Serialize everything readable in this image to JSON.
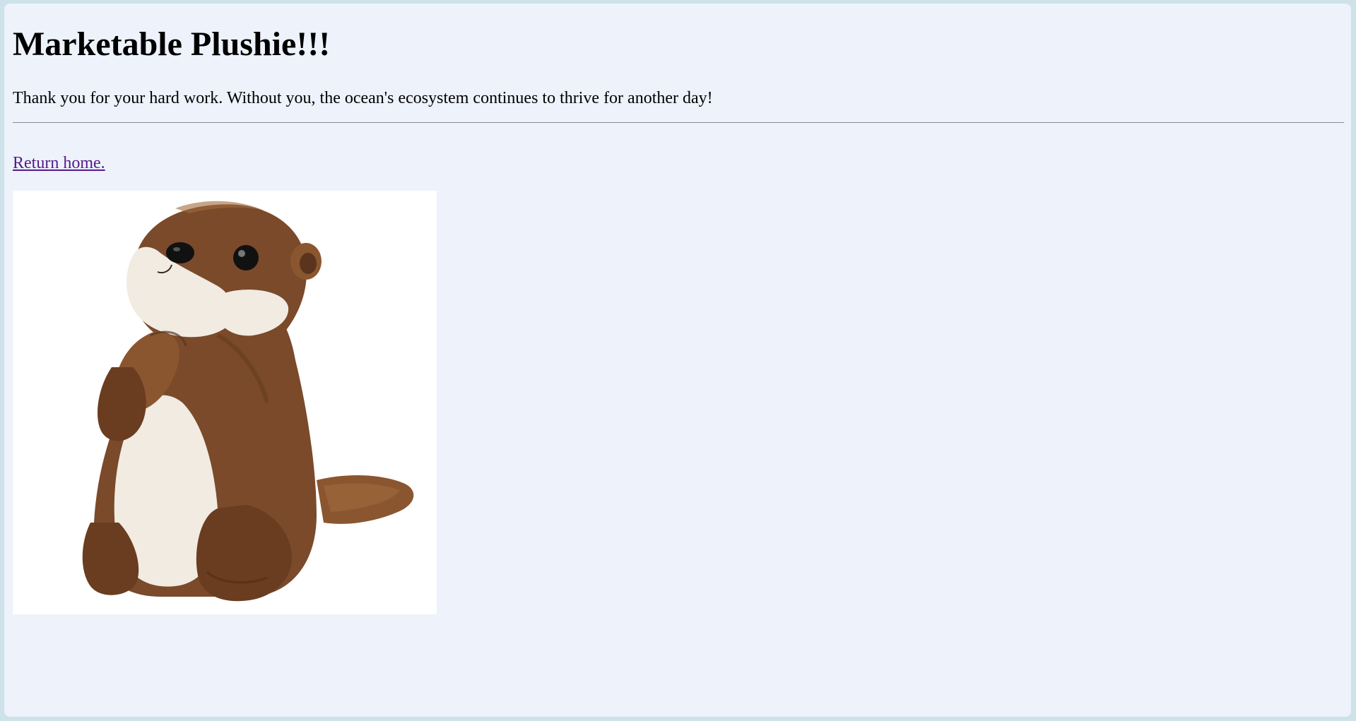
{
  "page": {
    "title": "Marketable Plushie!!!",
    "message": "Thank you for your hard work. Without you, the ocean's ecosystem continues to thrive for another day!",
    "home_link": "Return home."
  },
  "image": {
    "subject": "otter-plushie",
    "colors": {
      "fur": "#7a4a2a",
      "fur_dark": "#5a341c",
      "fur_light": "#a06a3e",
      "belly": "#f1ebe2",
      "eye": "#111111",
      "background": "#ffffff"
    }
  },
  "colors": {
    "page_background": "#edf2fb",
    "outer_background": "#cde3e9",
    "link_visited": "#551a8b",
    "divider": "#8a8e95"
  }
}
